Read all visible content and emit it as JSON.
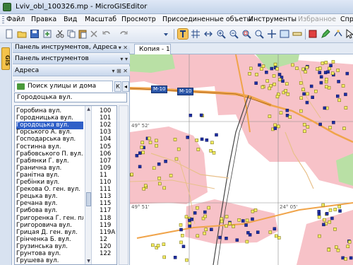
{
  "window": {
    "title": "Lviv_obl_100326.mp - MicroGISEditor"
  },
  "menu": {
    "items": [
      {
        "label": "Файл",
        "enabled": true
      },
      {
        "label": "Правка",
        "enabled": true
      },
      {
        "label": "Вид",
        "enabled": true
      },
      {
        "label": "Масштаб",
        "enabled": true
      },
      {
        "label": "Просмотр",
        "enabled": true
      },
      {
        "label": "Присоединенные объеты",
        "enabled": true
      },
      {
        "label": "Инструменты",
        "enabled": true
      },
      {
        "label": "Избранное",
        "enabled": false
      },
      {
        "label": "Спр",
        "enabled": true
      }
    ]
  },
  "side_tab": {
    "label": "GIS"
  },
  "panel": {
    "header_main": "Панель инструментов, Адреса",
    "header_tools": "Панель инструментов",
    "header_address": "Адреса",
    "search_tab": "Поиск улицы и дома",
    "search_value": "Городоцька вул.",
    "streets": [
      "Горобина вул.",
      "Городницька вул.",
      "Городоцька вул.",
      "Горського А. вул.",
      "Господарська вул.",
      "Гостинна вул.",
      "Грабовського П. вул.",
      "Грабянки Г. вул.",
      "Гранична вул.",
      "Гранітна вул.",
      "Гребінки вул.",
      "Грекова О. ген. вул.",
      "Грецька вул.",
      "Гречана вул.",
      "Грибова вул.",
      "Григоренка Г. ген. пл.",
      "Григоровича вул.",
      "Грицая Д. ген. вул.",
      "Грінченка Б. вул.",
      "Грузинська вул.",
      "Грунтова вул.",
      "Грушева вул."
    ],
    "selected_index": 2,
    "house_numbers": [
      "100",
      "101",
      "102",
      "103",
      "104",
      "105",
      "106",
      "107",
      "109",
      "11",
      "110",
      "111",
      "113",
      "115",
      "117",
      "118",
      "119",
      "119A",
      "12",
      "120",
      "122"
    ]
  },
  "map": {
    "tab_label": "Копия - 1",
    "road_labels": [
      "M-10",
      "M-10"
    ],
    "grid_labels": [
      "49° 52'",
      "49° 51'",
      "24° 05'"
    ],
    "colors": {
      "residential": "#f7c2c8",
      "forest": "#b9e0a5",
      "road": "#f0a44a",
      "building_yellow": "#f5ee63",
      "building_blue": "#1e2fa3",
      "grid": "#7f7f7f"
    }
  }
}
